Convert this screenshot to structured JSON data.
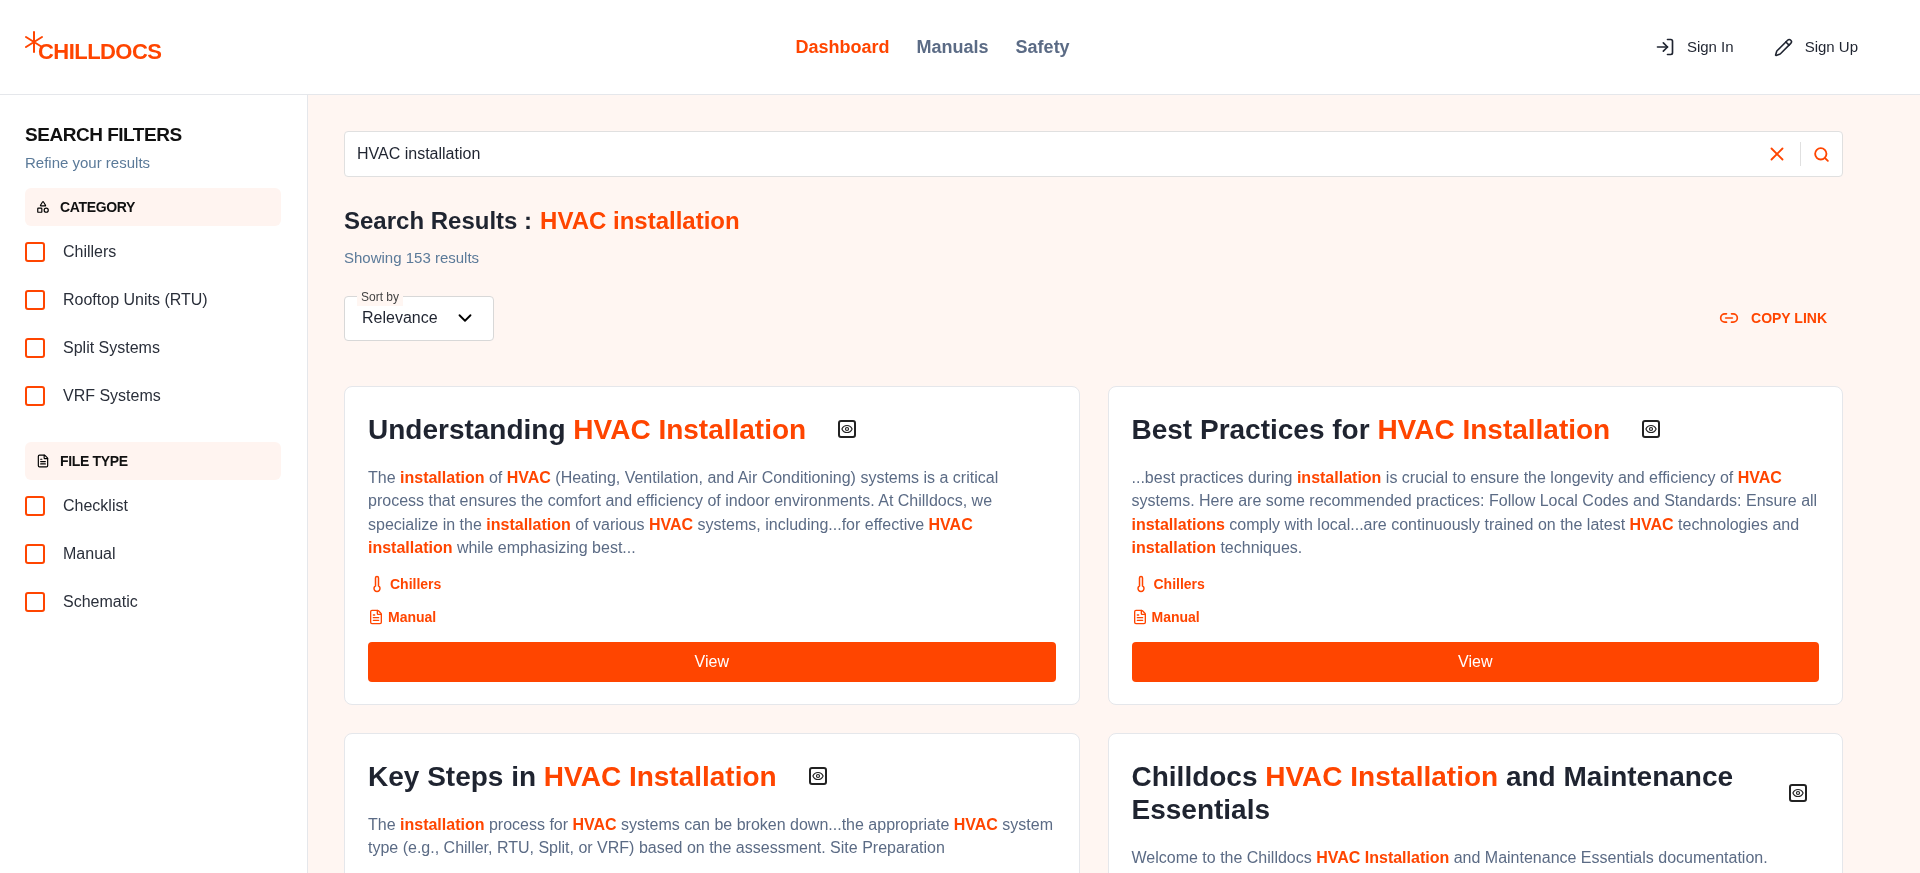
{
  "header": {
    "logo": "CHILLDOCS",
    "nav": [
      {
        "label": "Dashboard",
        "selected": true
      },
      {
        "label": "Manuals",
        "selected": false
      },
      {
        "label": "Safety",
        "selected": false
      }
    ],
    "actions": [
      {
        "kind": "sign-in",
        "label": "Sign In"
      },
      {
        "kind": "sign-up",
        "label": "Sign Up"
      }
    ]
  },
  "sidebar": {
    "title": "SEARCH FILTERS",
    "subtitle": "Refine your results",
    "groups": [
      {
        "kind": "category",
        "title": "CATEGORY",
        "options": [
          {
            "label": "Chillers",
            "checked": false
          },
          {
            "label": "Rooftop Units (RTU)",
            "checked": false
          },
          {
            "label": "Split Systems",
            "checked": false
          },
          {
            "label": "VRF Systems",
            "checked": false
          }
        ]
      },
      {
        "kind": "file",
        "title": "FILE TYPE",
        "options": [
          {
            "label": "Checklist",
            "checked": false
          },
          {
            "label": "Manual",
            "checked": false
          },
          {
            "label": "Schematic",
            "checked": false
          }
        ]
      }
    ]
  },
  "search": {
    "value": "HVAC installation"
  },
  "results": {
    "heading": "Search Results :",
    "query": "HVAC installation",
    "count": "Showing 153 results",
    "sort_label": "Sort by",
    "sort_value": "Relevance",
    "copy_link": "COPY LINK"
  },
  "cards": [
    {
      "title": "Understanding **HVAC Installation**",
      "excerpt": "The **installation** of **HVAC** (Heating, Ventilation, and Air Conditioning) systems is a critical process that ensures the comfort and efficiency of indoor environments. At Chilldocs, we specialize in the **installation** of various **HVAC** systems, including...for effective **HVAC installation** while emphasizing best...",
      "category": "Chillers",
      "file_type": "Manual",
      "button": "View"
    },
    {
      "title": "Best Practices for **HVAC Installation**",
      "excerpt": "...best practices during **installation** is crucial to ensure the longevity and efficiency of **HVAC** systems. Here are some recommended practices: Follow Local Codes and Standards: Ensure all **installations** comply with local...are continuously trained on the latest **HVAC** technologies and **installation** techniques.",
      "category": "Chillers",
      "file_type": "Manual",
      "button": "View"
    },
    {
      "title": "Key Steps in **HVAC Installation**",
      "excerpt": "The **installation** process for **HVAC** systems can be broken down...the appropriate **HVAC** system type (e.g., Chiller, RTU, Split, or VRF) based on the assessment. Site Preparation"
    },
    {
      "title": "Chilldocs **HVAC Installation** and Maintenance Essentials",
      "excerpt": "Welcome to the Chilldocs **HVAC Installation** and Maintenance Essentials documentation."
    }
  ]
}
